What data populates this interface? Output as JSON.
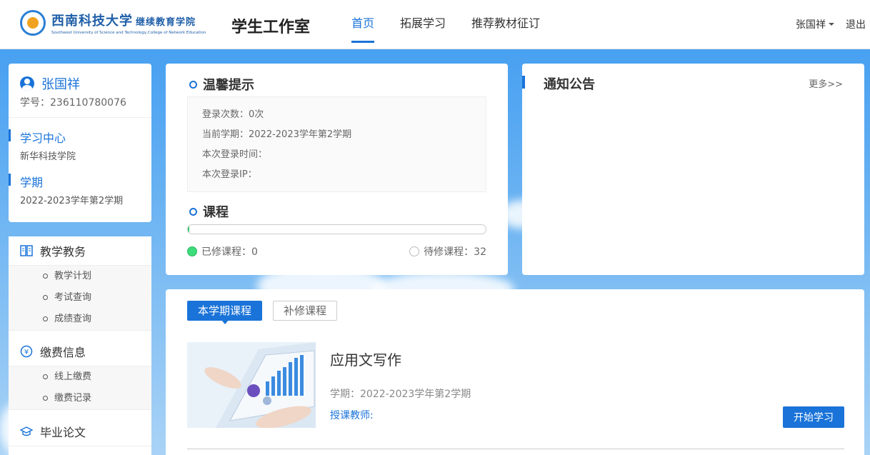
{
  "header": {
    "logo_cn": "西南科技大学",
    "logo_cn_sub": "继续教育学院",
    "logo_en": "Southwest University of Science and Technology,College of Network Education",
    "site_title": "学生工作室",
    "nav": [
      {
        "label": "首页",
        "active": true
      },
      {
        "label": "拓展学习",
        "active": false
      },
      {
        "label": "推荐教材征订",
        "active": false
      }
    ],
    "user_name": "张国祥",
    "logout": "退出"
  },
  "profile": {
    "name": "张国祥",
    "student_id": "学号：236110780076",
    "study_center_label": "学习中心",
    "study_center_value": "新华科技学院",
    "term_label": "学期",
    "term_value": "2022-2023学年第2学期"
  },
  "menu": {
    "sections": [
      {
        "label": "教学教务",
        "icon": "book-icon",
        "items": [
          "教学计划",
          "考试查询",
          "成绩查询"
        ]
      },
      {
        "label": "缴费信息",
        "icon": "yen-icon",
        "items": [
          "线上缴费",
          "缴费记录"
        ]
      },
      {
        "label": "毕业论文",
        "icon": "graduation-cap-icon",
        "items": []
      }
    ]
  },
  "tips": {
    "title": "温馨提示",
    "login_count": "登录次数：0次",
    "current_term": "当前学期：2022-2023学年第2学期",
    "login_time": "本次登录时间：",
    "login_ip": "本次登录IP："
  },
  "course_progress": {
    "title": "课程",
    "completed_label": "已修课程：0",
    "pending_label": "待修课程：32",
    "completed": 0,
    "pending": 32
  },
  "notice": {
    "title": "通知公告",
    "more": "更多>>"
  },
  "courses": {
    "tabs": [
      {
        "label": "本学期课程",
        "active": true
      },
      {
        "label": "补修课程",
        "active": false
      }
    ],
    "list": [
      {
        "title": "应用文写作",
        "term": "学期：2022-2023学年第2学期",
        "teacher": "授课教师:",
        "button": "开始学习"
      }
    ]
  },
  "colors": {
    "accent": "#1a73d8",
    "done": "#3ddc7a"
  }
}
